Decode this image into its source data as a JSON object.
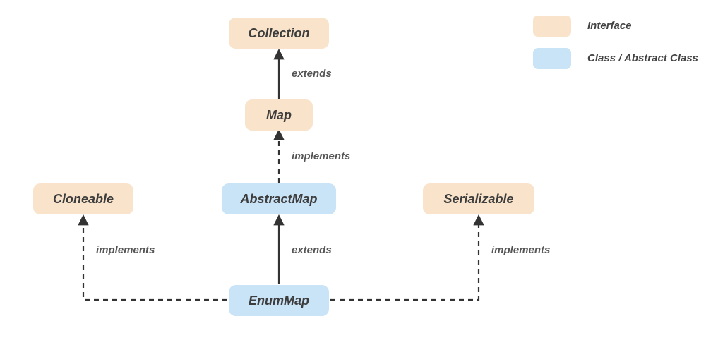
{
  "nodes": {
    "collection": {
      "label": "Collection",
      "type": "interface"
    },
    "map": {
      "label": "Map",
      "type": "interface"
    },
    "abstractmap": {
      "label": "AbstractMap",
      "type": "class"
    },
    "enummap": {
      "label": "EnumMap",
      "type": "class"
    },
    "cloneable": {
      "label": "Cloneable",
      "type": "interface"
    },
    "serializable": {
      "label": "Serializable",
      "type": "interface"
    }
  },
  "edges": {
    "map_to_collection": {
      "label": "extends",
      "style": "solid"
    },
    "abstractmap_to_map": {
      "label": "implements",
      "style": "dashed"
    },
    "enummap_to_abstractmap": {
      "label": "extends",
      "style": "solid"
    },
    "enummap_to_cloneable": {
      "label": "implements",
      "style": "dashed"
    },
    "enummap_to_serializable": {
      "label": "implements",
      "style": "dashed"
    }
  },
  "legend": {
    "interface": "Interface",
    "class": "Class / Abstract Class"
  },
  "colors": {
    "interface_bg": "#f9e3ca",
    "class_bg": "#c9e3f7",
    "arrow": "#333333",
    "text": "#3d3d3d"
  }
}
